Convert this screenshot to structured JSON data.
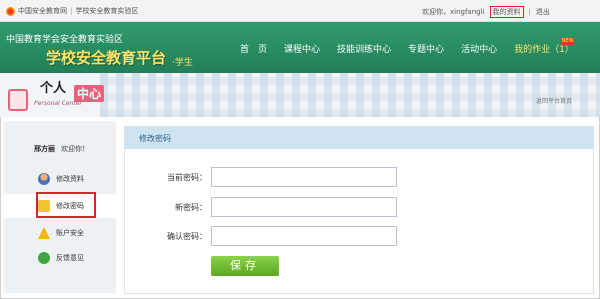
{
  "topbar": {
    "site_name": "中国安全教育网",
    "separator": "|",
    "lab_name": "学校安全教育实验区",
    "welcome": "欢迎你，xingfangli",
    "profile_link": "我的资料",
    "logout": "退出"
  },
  "banner": {
    "org": "中国教育学会安全教育实验区",
    "title": "学校安全教育平台",
    "role": "·学生",
    "nav": [
      "首　页",
      "课程中心",
      "技能训练中心",
      "专题中心",
      "活动中心",
      "我的作业（1）"
    ],
    "badge": "NEW"
  },
  "personal_center": {
    "line1": "个人",
    "line2": "中心",
    "en": "Personal Center",
    "back": "返回平台首页"
  },
  "sidebar": {
    "user": "邢方丽",
    "greeting": "欢迎你！",
    "items": [
      {
        "label": "修改资料",
        "icon": "user-icon"
      },
      {
        "label": "修改密码",
        "icon": "lock-icon"
      },
      {
        "label": "账户安全",
        "icon": "warning-icon"
      },
      {
        "label": "反馈意见",
        "icon": "feedback-icon"
      }
    ]
  },
  "form": {
    "title": "修改密码",
    "current_label": "当前密码：",
    "new_label": "新密码：",
    "confirm_label": "确认密码：",
    "save": "保存"
  },
  "colors": {
    "header_green": "#2f9b6e",
    "highlight": "#d8252b",
    "save_green": "#6cbf2a"
  }
}
